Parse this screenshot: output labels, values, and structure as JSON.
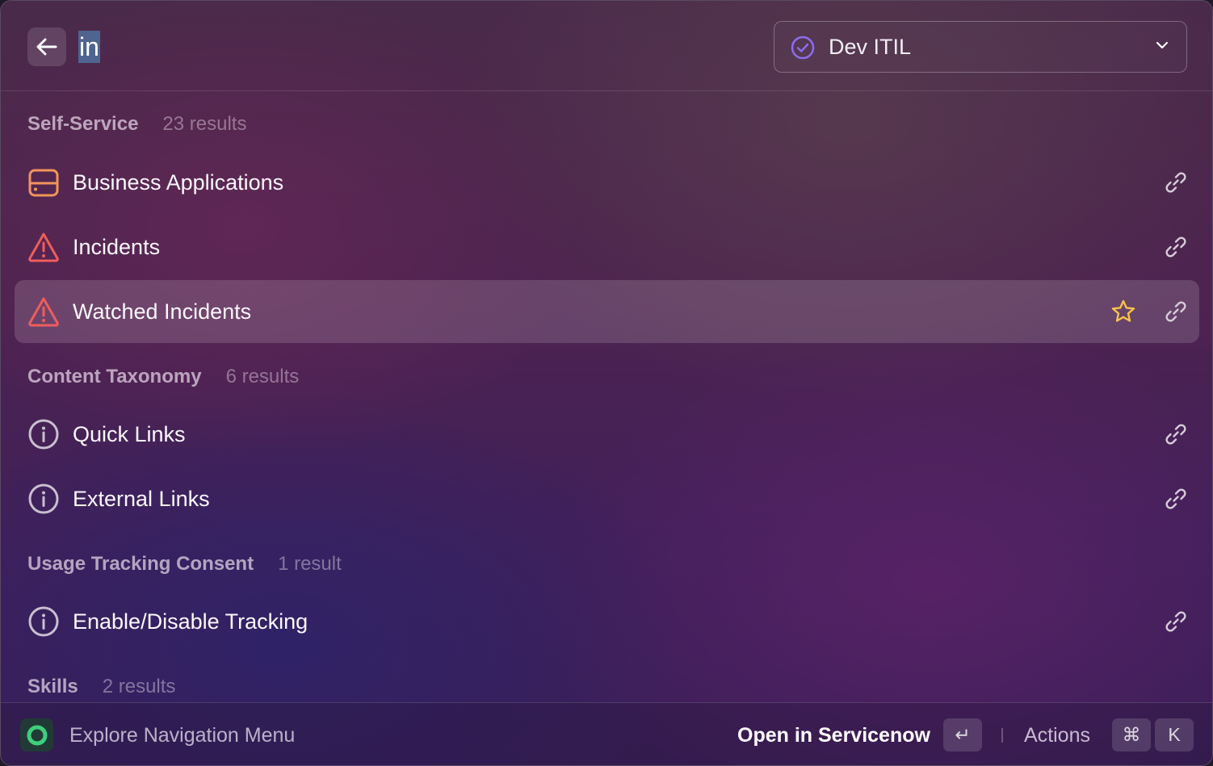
{
  "search": {
    "query": "in"
  },
  "environment": {
    "selected": "Dev ITIL"
  },
  "sections": [
    {
      "title": "Self-Service",
      "count": "23 results",
      "items": [
        {
          "label": "Business Applications",
          "icon": "server-icon"
        },
        {
          "label": "Incidents",
          "icon": "warning-icon"
        },
        {
          "label": "Watched Incidents",
          "icon": "warning-icon",
          "selected": true,
          "favorite": true
        }
      ]
    },
    {
      "title": "Content Taxonomy",
      "count": "6 results",
      "items": [
        {
          "label": "Quick Links",
          "icon": "info-icon"
        },
        {
          "label": "External Links",
          "icon": "info-icon"
        }
      ]
    },
    {
      "title": "Usage Tracking Consent",
      "count": "1 result",
      "items": [
        {
          "label": "Enable/Disable Tracking",
          "icon": "info-icon"
        }
      ]
    },
    {
      "title": "Skills",
      "count": "2 results",
      "items": []
    }
  ],
  "footer": {
    "left_label": "Explore Navigation Menu",
    "primary_action": "Open in Servicenow",
    "enter_key": "↵",
    "actions_label": "Actions",
    "cmd_key": "⌘",
    "k_key": "K"
  },
  "colors": {
    "server_icon": "#f2955a",
    "warning_icon": "#ef5d5d",
    "info_icon": "#c9bfd0",
    "star": "#f7c24a",
    "env_check": "#8b6cf0",
    "logo_green": "#3ecf7a"
  }
}
